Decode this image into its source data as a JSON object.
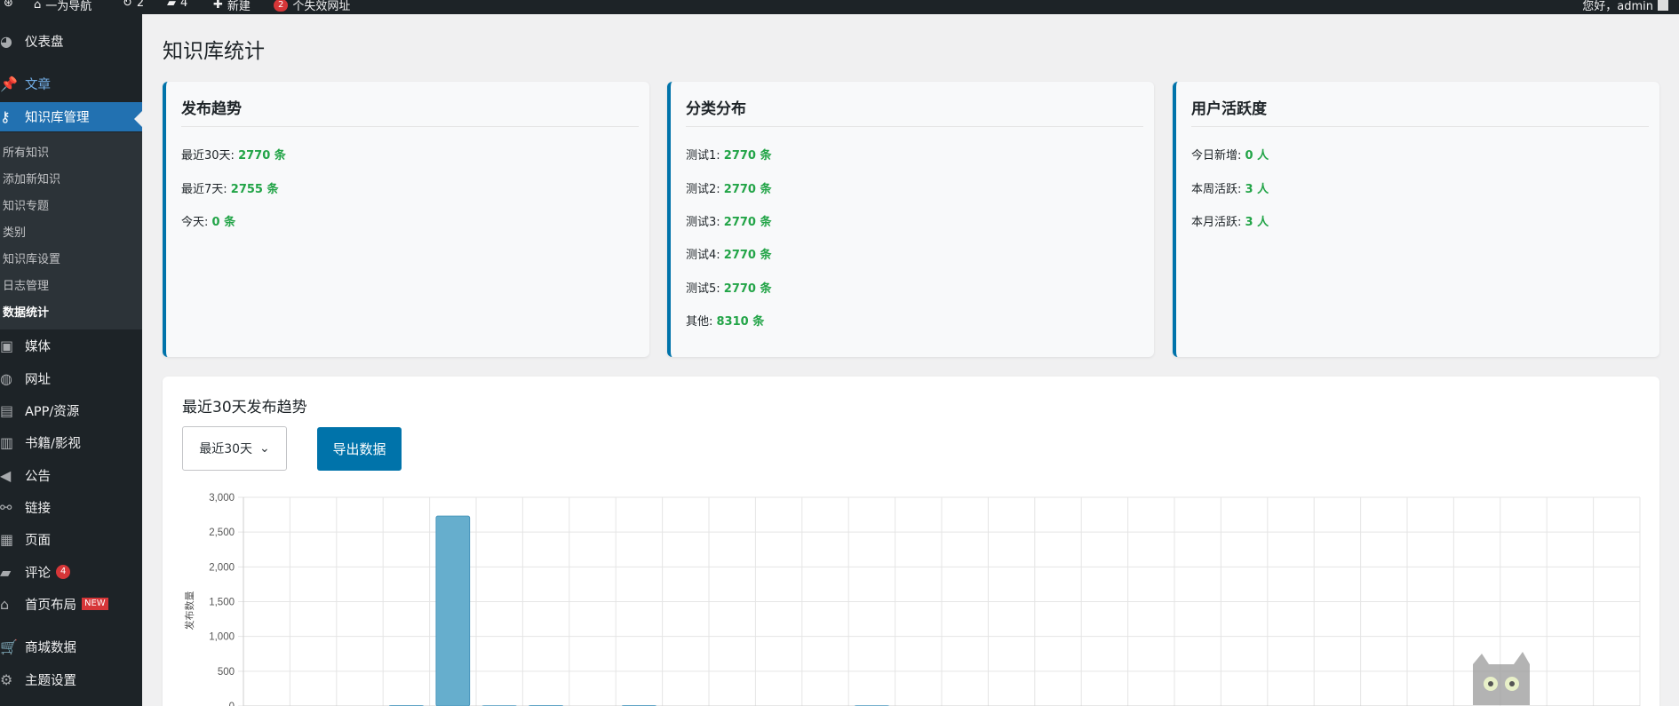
{
  "adminbar": {
    "site_name": "一为导航",
    "updates": "2",
    "comments": "4",
    "new_label": "新建",
    "broken_count": "2",
    "broken_label": "个失效网址",
    "greeting": "您好，admin"
  },
  "sidebar": {
    "items": [
      {
        "label": "仪表盘",
        "icon": "dashboard-icon"
      },
      {
        "label": "文章",
        "icon": "pin-icon"
      },
      {
        "label": "知识库管理",
        "icon": "key-icon"
      },
      {
        "label": "媒体",
        "icon": "media-icon"
      },
      {
        "label": "网址",
        "icon": "globe-icon"
      },
      {
        "label": "APP/资源",
        "icon": "app-icon"
      },
      {
        "label": "书籍/影视",
        "icon": "book-icon"
      },
      {
        "label": "公告",
        "icon": "megaphone-icon"
      },
      {
        "label": "链接",
        "icon": "link-icon"
      },
      {
        "label": "页面",
        "icon": "page-icon"
      },
      {
        "label": "评论",
        "icon": "comment-icon",
        "badge": "4"
      },
      {
        "label": "首页布局",
        "icon": "home-icon",
        "badge": "NEW"
      },
      {
        "label": "商城数据",
        "icon": "cart-icon"
      },
      {
        "label": "主题设置",
        "icon": "gear-icon"
      }
    ],
    "submenu": [
      "所有知识",
      "添加新知识",
      "知识专题",
      "类别",
      "知识库设置",
      "日志管理",
      "数据统计"
    ]
  },
  "page_title": "知识库统计",
  "cards": {
    "publish": {
      "title": "发布趋势",
      "rows": [
        {
          "label": "最近30天: ",
          "value": "2770 条"
        },
        {
          "label": "最近7天: ",
          "value": "2755 条"
        },
        {
          "label": "今天: ",
          "value": "0 条"
        }
      ]
    },
    "category": {
      "title": "分类分布",
      "rows": [
        {
          "label": "测试1: ",
          "value": "2770 条"
        },
        {
          "label": "测试2: ",
          "value": "2770 条"
        },
        {
          "label": "测试3: ",
          "value": "2770 条"
        },
        {
          "label": "测试4: ",
          "value": "2770 条"
        },
        {
          "label": "测试5: ",
          "value": "2770 条"
        },
        {
          "label": "其他: ",
          "value": "8310 条"
        }
      ]
    },
    "activity": {
      "title": "用户活跃度",
      "rows": [
        {
          "label": "今日新增: ",
          "value": "0 人"
        },
        {
          "label": "本周活跃: ",
          "value": "3 人"
        },
        {
          "label": "本月活跃: ",
          "value": "3 人"
        }
      ]
    }
  },
  "chart_panel": {
    "title": "最近30天发布趋势",
    "range_value": "最近30天",
    "export_label": "导出数据"
  },
  "chart_data": {
    "type": "bar",
    "ylabel": "发布数量",
    "ylim": [
      0,
      3000
    ],
    "yticks": [
      "0",
      "500",
      "1,000",
      "1,500",
      "2,000",
      "2,500",
      "3,000"
    ],
    "values": [
      0,
      0,
      0,
      5,
      2730,
      3,
      5,
      0,
      5,
      0,
      0,
      0,
      0,
      3,
      0,
      0,
      0,
      0,
      0,
      0,
      0,
      0,
      0,
      0,
      0,
      0,
      0,
      0,
      0,
      0
    ],
    "color": "#66aecd",
    "grid": true
  }
}
